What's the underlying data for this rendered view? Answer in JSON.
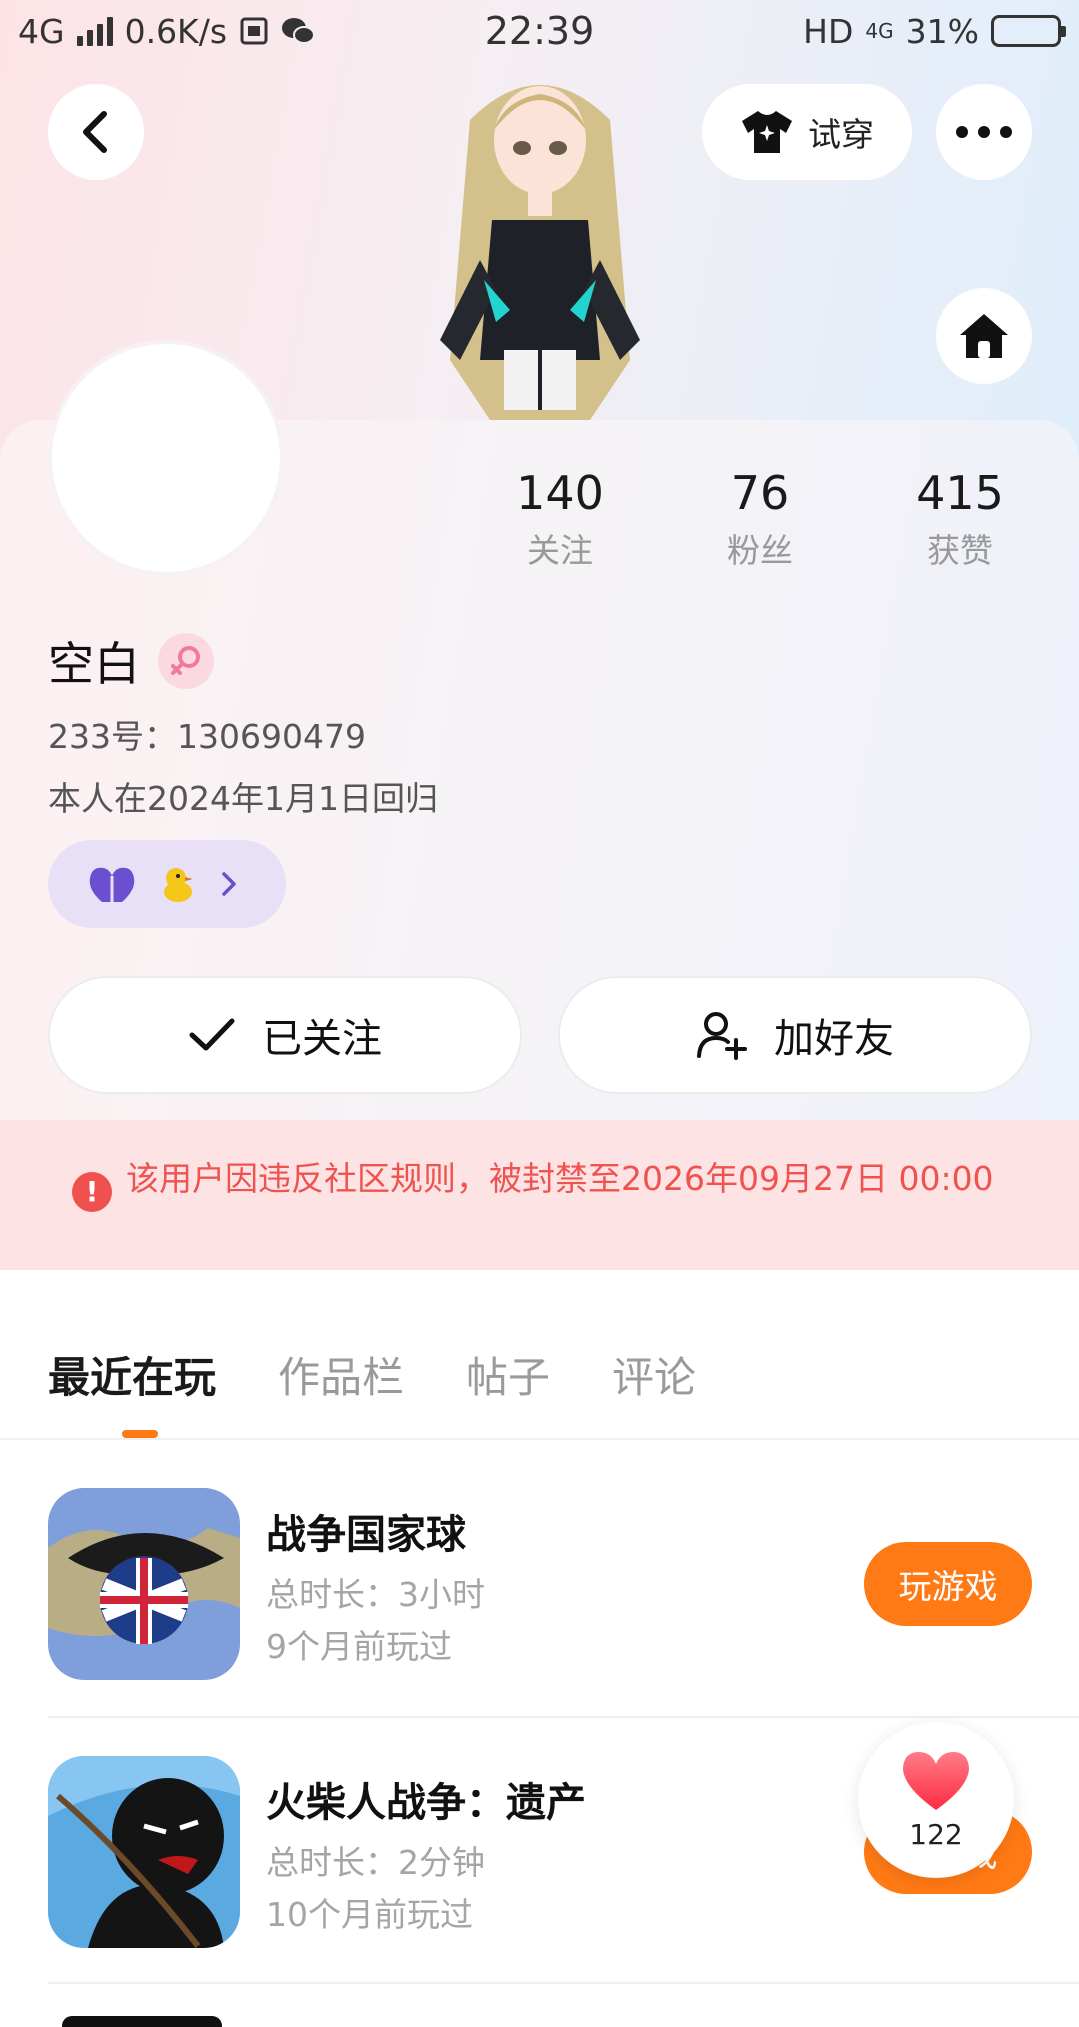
{
  "status_bar": {
    "network": "4G",
    "speed": "0.6K/s",
    "time": "22:39",
    "hd": "HD",
    "net_right": "4G",
    "battery": "31%",
    "battery_level": 0.31
  },
  "header": {
    "try_on_label": "试穿"
  },
  "profile": {
    "name": "空白",
    "id_line": "233号：130690479",
    "bio": "本人在2024年1月1日回归",
    "stats": [
      {
        "value": "140",
        "label": "关注"
      },
      {
        "value": "76",
        "label": "粉丝"
      },
      {
        "value": "415",
        "label": "获赞"
      }
    ]
  },
  "actions": {
    "following_label": "已关注",
    "add_friend_label": "加好友"
  },
  "ban_notice": {
    "text": "该用户因违反社区规则，被封禁至2026年09月27日 00:00"
  },
  "tabs": [
    {
      "label": "最近在玩",
      "active": true
    },
    {
      "label": "作品栏",
      "active": false
    },
    {
      "label": "帖子",
      "active": false
    },
    {
      "label": "评论",
      "active": false
    }
  ],
  "games": [
    {
      "title": "战争国家球",
      "duration": "总时长：3小时",
      "last_played": "9个月前玩过",
      "button": "玩游戏"
    },
    {
      "title": "火柴人战争：遗产",
      "duration": "总时长：2分钟",
      "last_played": "10个月前玩过",
      "button": "玩游戏"
    }
  ],
  "like_float": {
    "count": "122"
  },
  "colors": {
    "accent": "#ff7a14",
    "ban_text": "#ef5350",
    "ban_bg": "#fde3e3"
  }
}
